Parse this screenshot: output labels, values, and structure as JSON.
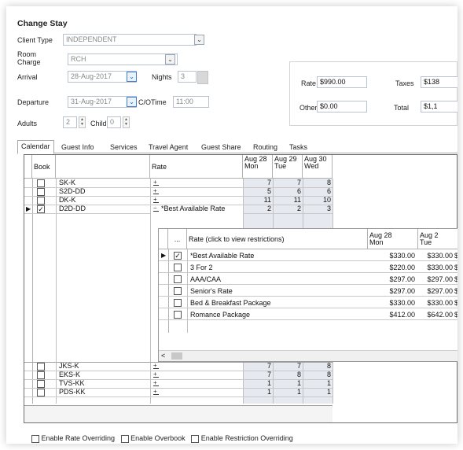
{
  "window": {
    "title": "Change Stay"
  },
  "form": {
    "client_type_label": "Client Type",
    "client_type_value": "INDEPENDENT",
    "room_charge_label": "Room\nCharge",
    "room_charge_value": "RCH",
    "arrival_label": "Arrival",
    "arrival_value": "28-Aug-2017",
    "nights_label": "Nights",
    "nights_value": "3",
    "departure_label": "Departure",
    "departure_value": "31-Aug-2017",
    "co_time_label": "C/OTime",
    "co_time_value": "11:00",
    "adults_label": "Adults",
    "adults_value": "2",
    "child_label": "Child",
    "child_value": "0"
  },
  "rates": {
    "rate_label": "Rate",
    "rate_value": "$990.00",
    "taxes_label": "Taxes",
    "taxes_value": "$138",
    "other_label": "Other",
    "other_value": "$0.00",
    "total_label": "Total",
    "total_value": "$1,1"
  },
  "tabs": [
    "Calendar",
    "Guest Info",
    "Services",
    "Travel Agent",
    "Guest Share",
    "Routing",
    "Tasks"
  ],
  "grid": {
    "headers": {
      "book": "Book",
      "rate": "Rate",
      "dates": [
        "Aug 28\nMon",
        "Aug 29\nTue",
        "Aug 30\nWed"
      ]
    },
    "rows_top": [
      {
        "room": "SK-K",
        "checked": false,
        "rate": "",
        "vals": [
          "7",
          "7",
          "8"
        ]
      },
      {
        "room": "S2D-DD",
        "checked": false,
        "rate": "",
        "vals": [
          "5",
          "6",
          "6"
        ]
      },
      {
        "room": "DK-K",
        "checked": false,
        "rate": "",
        "vals": [
          "11",
          "11",
          "10"
        ]
      },
      {
        "room": "D2D-DD",
        "checked": true,
        "rate": "*Best Available Rate",
        "vals": [
          "2",
          "2",
          "3"
        ]
      }
    ],
    "rows_bottom": [
      {
        "room": "JKS-K",
        "checked": false,
        "vals": [
          "7",
          "7",
          "8"
        ]
      },
      {
        "room": "EKS-K",
        "checked": false,
        "vals": [
          "7",
          "8",
          "8"
        ]
      },
      {
        "room": "TVS-KK",
        "checked": false,
        "vals": [
          "1",
          "1",
          "1"
        ]
      },
      {
        "room": "PDS-KK",
        "checked": false,
        "vals": [
          "1",
          "1",
          "1"
        ]
      }
    ]
  },
  "subgrid": {
    "ellipsis": "...",
    "header": "Rate (click to view restrictions)",
    "date1": "Aug 28\nMon",
    "date2": "Aug 2\nTue",
    "rows": [
      {
        "name": "*Best Available Rate",
        "checked": true,
        "c1": "$330.00",
        "c2": "$330.00",
        "c3": "$:"
      },
      {
        "name": "3 For 2",
        "checked": false,
        "c1": "$220.00",
        "c2": "$330.00",
        "c3": "$:"
      },
      {
        "name": "AAA/CAA",
        "checked": false,
        "c1": "$297.00",
        "c2": "$297.00",
        "c3": "$:"
      },
      {
        "name": "Senior's Rate",
        "checked": false,
        "c1": "$297.00",
        "c2": "$297.00",
        "c3": "$:"
      },
      {
        "name": "Bed & Breakfast Package",
        "checked": false,
        "c1": "$330.00",
        "c2": "$330.00",
        "c3": "$:"
      },
      {
        "name": "Romance Package",
        "checked": false,
        "c1": "$412.00",
        "c2": "$642.00",
        "c3": "$:"
      }
    ],
    "scroll_left": "<"
  },
  "footer": {
    "opt1": "Enable Rate Overriding",
    "opt2": "Enable Overbook",
    "opt3": "Enable Restriction Overriding"
  },
  "icons": {
    "dropdown": "chevron-down-icon",
    "row_pointer": "triangle-right-icon",
    "expand": "plus-icon",
    "collapse": "minus-icon"
  }
}
